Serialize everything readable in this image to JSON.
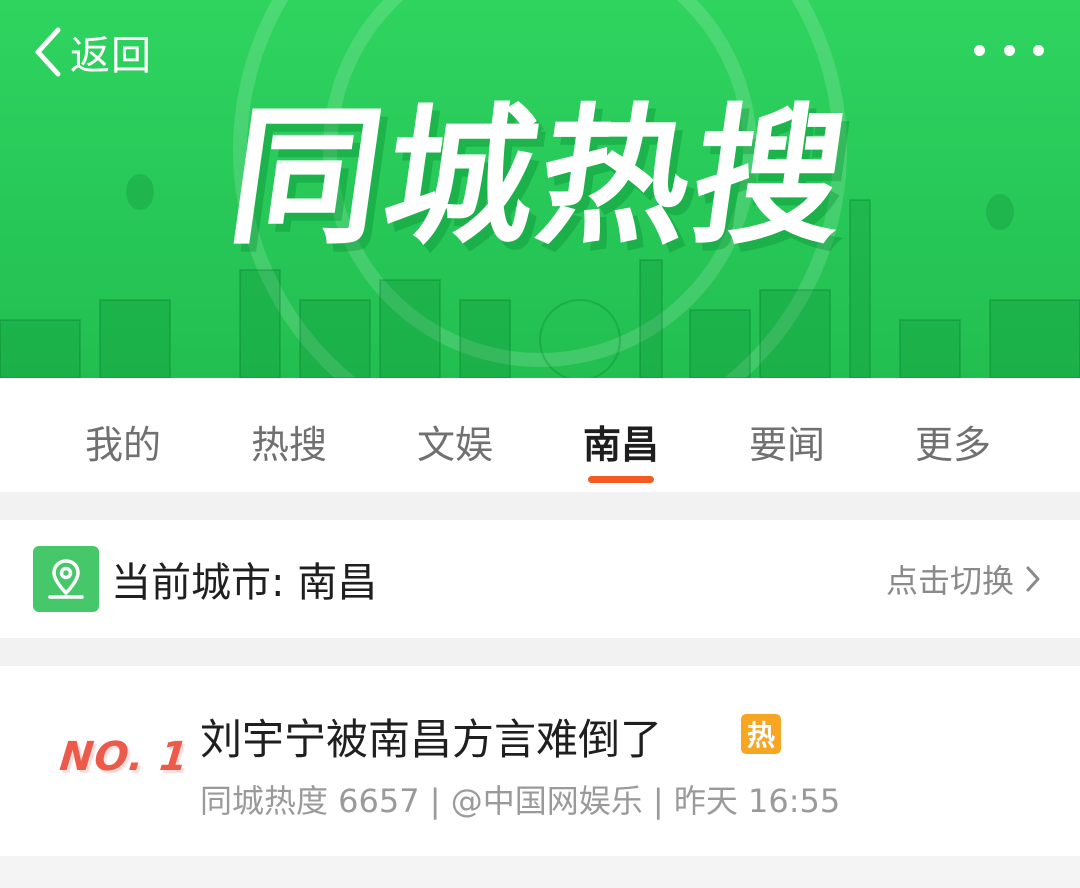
{
  "header": {
    "back_label": "返回",
    "title": "同城热搜",
    "more_icon": "more-dots-icon"
  },
  "tabs": [
    {
      "label": "我的",
      "active": false
    },
    {
      "label": "热搜",
      "active": false
    },
    {
      "label": "文娱",
      "active": false
    },
    {
      "label": "南昌",
      "active": true
    },
    {
      "label": "要闻",
      "active": false
    },
    {
      "label": "更多",
      "active": false
    }
  ],
  "city": {
    "label": "当前城市: 南昌",
    "switch_label": "点击切换",
    "icon": "location-pin-icon"
  },
  "list": [
    {
      "rank": "NO. 1",
      "title": "刘宇宁被南昌方言难倒了",
      "badge": "热",
      "meta": "同城热度 6657 | @中国网娱乐 | 昨天 16:55"
    }
  ],
  "colors": {
    "banner_green": "#27c858",
    "tab_accent": "#f45a22",
    "pin_green": "#46c86a",
    "hot_badge": "#f7a623",
    "rank_red": "#ee5a4a"
  }
}
